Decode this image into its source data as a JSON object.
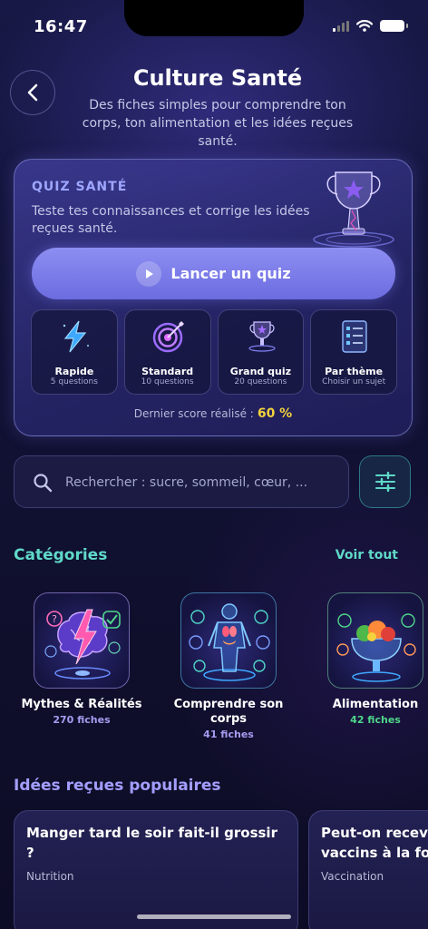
{
  "status_bar": {
    "time": "16:47"
  },
  "header": {
    "title": "Culture Santé",
    "subtitle": "Des fiches simples pour comprendre ton corps, ton alimentation et les idées reçues santé."
  },
  "quiz": {
    "label": "QUIZ SANTÉ",
    "description": "Teste tes connaissances et corrige les idées reçues santé.",
    "launch_label": "Lancer un quiz",
    "modes": [
      {
        "name": "Rapide",
        "sub": "5 questions",
        "icon": "lightning-icon"
      },
      {
        "name": "Standard",
        "sub": "10 questions",
        "icon": "target-icon"
      },
      {
        "name": "Grand quiz",
        "sub": "20 questions",
        "icon": "trophy-icon"
      },
      {
        "name": "Par thème",
        "sub": "Choisir un sujet",
        "icon": "checklist-icon"
      }
    ],
    "score_label": "Dernier score réalisé :",
    "score_value": "60 %"
  },
  "search": {
    "placeholder": "Rechercher : sucre, sommeil, cœur, ..."
  },
  "categories": {
    "title": "Catégories",
    "see_all": "Voir tout",
    "items": [
      {
        "name": "Mythes & Réalités",
        "count": "270 fiches",
        "count_color": "#a69cf0",
        "icon": "brain-lightning-icon"
      },
      {
        "name": "Comprendre son corps",
        "count": "41 fiches",
        "count_color": "#a69cf0",
        "icon": "human-body-icon"
      },
      {
        "name": "Alimentation",
        "count": "42 fiches",
        "count_color": "#4fd68a",
        "icon": "food-bowl-icon"
      }
    ]
  },
  "popular": {
    "title": "Idées reçues populaires",
    "items": [
      {
        "question": "Manger tard le soir fait-il grossir ?",
        "tag": "Nutrition"
      },
      {
        "question": "Peut-on recevoir plusieurs vaccins à la fois ?",
        "tag": "Vaccination"
      }
    ]
  }
}
